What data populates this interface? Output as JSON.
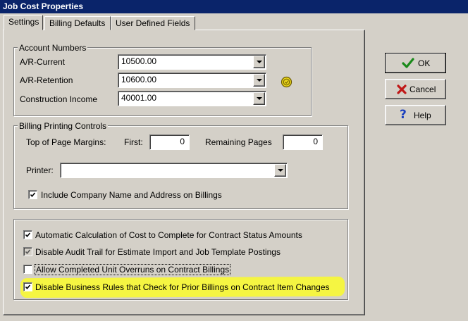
{
  "window": {
    "title": "Job Cost Properties"
  },
  "tabs": [
    {
      "label": "Settings",
      "active": true
    },
    {
      "label": "Billing Defaults",
      "active": false
    },
    {
      "label": "User Defined Fields",
      "active": false
    }
  ],
  "account_numbers": {
    "legend": "Account Numbers",
    "ar_current": {
      "label": "A/R-Current",
      "value": "10500.00"
    },
    "ar_retention": {
      "label": "A/R-Retention",
      "value": "10600.00"
    },
    "construction_income": {
      "label": "Construction Income",
      "value": "40001.00"
    },
    "lookup_icon": "coin-icon"
  },
  "billing_printing": {
    "legend": "Billing Printing Controls",
    "margins_label": "Top of Page Margins:",
    "first_label": "First:",
    "first_value": "0",
    "remaining_label": "Remaining Pages",
    "remaining_value": "0",
    "printer_label": "Printer:",
    "printer_value": "",
    "include_company": {
      "label": "Include Company Name and Address on Billings",
      "checked": true
    }
  },
  "options": [
    {
      "label": "Automatic Calculation of Cost to Complete for Contract Status Amounts",
      "checked": true,
      "disabled": false
    },
    {
      "label": "Disable Audit Trail for Estimate Import and Job Template Postings",
      "checked": true,
      "disabled": true
    },
    {
      "label": "Allow Completed Unit Overruns on Contract Billings",
      "checked": false,
      "disabled": false
    },
    {
      "label": "Disable Business Rules that Check for Prior Billings on Contract Item Changes",
      "checked": true,
      "disabled": false,
      "highlighted": true
    }
  ],
  "buttons": {
    "ok": {
      "label": "OK",
      "icon": "checkmark-icon",
      "color": "#1a8a1a"
    },
    "cancel": {
      "label": "Cancel",
      "icon": "x-icon",
      "color": "#c01818"
    },
    "help": {
      "label": "Help",
      "icon": "question-icon",
      "color": "#1a3fbf"
    }
  },
  "colors": {
    "highlight": "#f5f542",
    "titlebar": "#0a246a",
    "face": "#d4d0c8"
  }
}
